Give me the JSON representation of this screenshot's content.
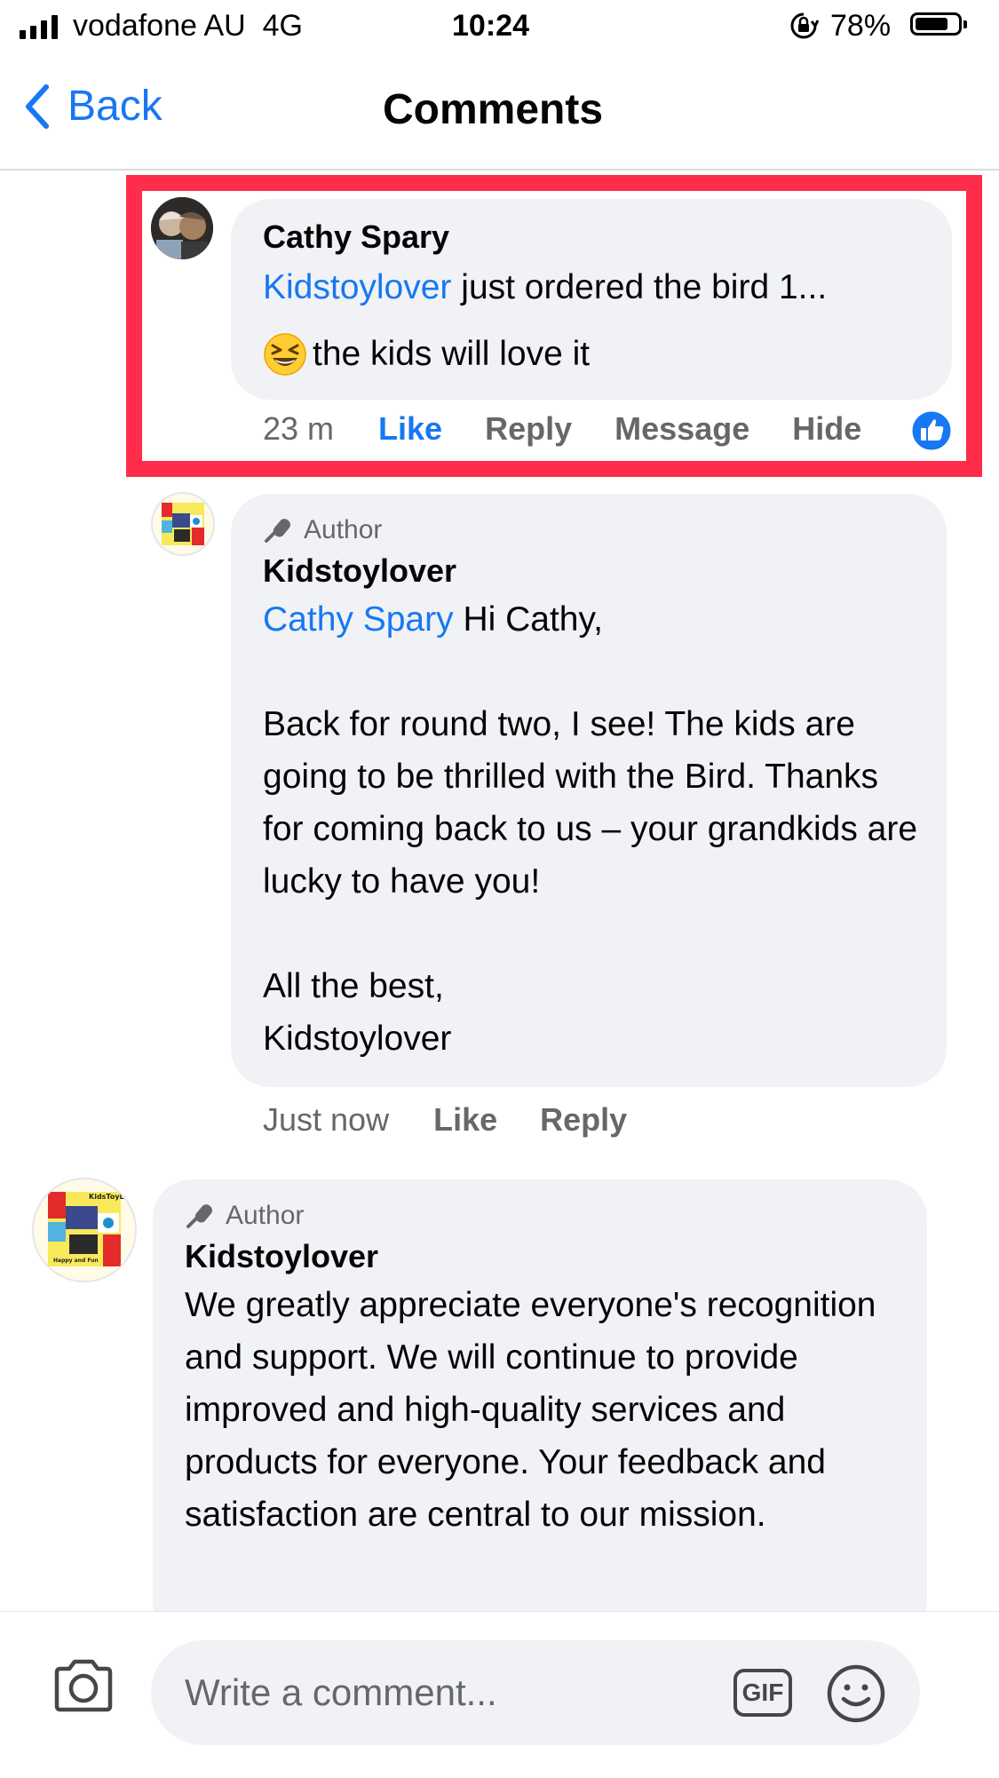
{
  "status_bar": {
    "carrier": "vodafone AU",
    "network": "4G",
    "time": "10:24",
    "battery": "78%",
    "battery_level": 0.78
  },
  "nav": {
    "back_label": "Back",
    "title": "Comments"
  },
  "comments": [
    {
      "author": "Cathy Spary",
      "mention": "Kidstoylover",
      "text_line1": " just ordered the bird 1...",
      "emoji": "grinning-squinting-face",
      "text_line2": " the kids will love it",
      "time": "23 m",
      "actions": [
        "Like",
        "Reply",
        "Message",
        "Hide"
      ],
      "reaction": "like"
    },
    {
      "badge": "Author",
      "author": "Kidstoylover",
      "mention": "Cathy Spary",
      "greeting": " Hi Cathy,",
      "paragraph": "Back for round two, I see! The kids are going to be thrilled with the Bird. Thanks for coming back to us – your grandkids are lucky to have you!",
      "sign_off": "All the best,",
      "signature": "Kidstoylover",
      "time": "Just now",
      "actions": [
        "Like",
        "Reply"
      ]
    },
    {
      "badge": "Author",
      "author": "Kidstoylover",
      "text": "We greatly appreciate everyone's recognition and support. We will continue to provide improved and high-quality services and products for everyone. Your feedback and satisfaction are central to our mission."
    }
  ],
  "logo": {
    "brand": "KidsToyLover",
    "tagline": "Happy and Fun"
  },
  "composer": {
    "placeholder": "Write a comment...",
    "gif_label": "GIF"
  },
  "colors": {
    "accent": "#1877f2",
    "bubble": "#f0f2f5",
    "highlight": "#ff2d4b",
    "secondary_text": "#65676b"
  }
}
